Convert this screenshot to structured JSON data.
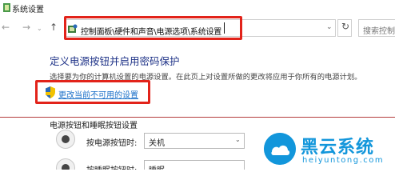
{
  "window": {
    "title": "系统设置"
  },
  "toolbar": {
    "address": "控制面板\\硬件和声音\\电源选项\\系统设置",
    "search_placeholder": "搜索控制面"
  },
  "main": {
    "heading": "定义电源按钮并启用密码保护",
    "description": "选择要为你的计算机设置的电源设置。在此页上对设置所做的更改将应用于你所有的电源计划。",
    "change_link": "更改当前不可用的设置",
    "section_title": "电源按钮和睡眠按钮设置",
    "rows": [
      {
        "label": "按电源按钮时:",
        "value": "关机"
      },
      {
        "label": "按睡眠按钮时:",
        "value": "睡眠"
      }
    ]
  },
  "watermark": {
    "name": "黑云系统",
    "url": "heiyuntong.com"
  },
  "colors": {
    "highlight_border": "#e2231a",
    "heading": "#1e3287",
    "link": "#1a6fc8",
    "watermark": "#1296db"
  }
}
